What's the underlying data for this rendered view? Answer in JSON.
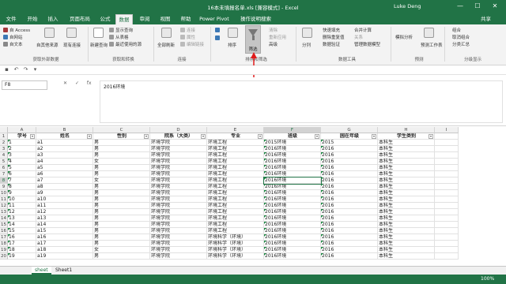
{
  "window": {
    "title": "16本未填报名单.xls [兼容模式] - Excel",
    "user": "Luke Deng",
    "min": "—",
    "max": "☐",
    "close": "✕"
  },
  "tabs": [
    "文件",
    "开始",
    "插入",
    "页面布局",
    "公式",
    "数据",
    "审阅",
    "视图",
    "帮助",
    "Power Pivot"
  ],
  "active_tab": "数据",
  "tell_me": "操作说明搜索",
  "share": "共享",
  "ribbon": {
    "get_data": {
      "access": "自 Access",
      "web": "自网站",
      "text": "自文本",
      "other": "自其他来源",
      "existing": "现有连接",
      "new_query": "新建查询",
      "show_query": "显示查询",
      "from_table": "从表格",
      "recent": "最近使用的源",
      "group1": "获取外部数据",
      "group2": "获取和转换"
    },
    "connections": {
      "refresh": "全部刷新",
      "conn": "连接",
      "props": "属性",
      "edit_links": "编辑链接",
      "group": "连接"
    },
    "sort_filter": {
      "sort": "排序",
      "filter": "筛选",
      "clear": "清除",
      "reapply": "重新应用",
      "advanced": "高级",
      "group": "排序和筛选"
    },
    "data_tools": {
      "split": "分列",
      "flash": "快速填充",
      "remove_dup": "删除重复值",
      "validation": "数据验证",
      "consolidate": "合并计算",
      "relations": "关系",
      "model": "管理数据模型",
      "group": "数据工具"
    },
    "forecast": {
      "what_if": "模拟分析",
      "sheet": "预测工作表",
      "group": "预测"
    },
    "outline": {
      "group_btn": "组合",
      "ungroup": "取消组合",
      "subtotal": "分类汇总",
      "group": "分级显示"
    }
  },
  "name_box": "F8",
  "formula": "2016环境",
  "columns": [
    "A",
    "B",
    "C",
    "D",
    "E",
    "F",
    "G",
    "H",
    "I"
  ],
  "selected_column": "F",
  "selected_row": 8,
  "headers": [
    "学号",
    "姓名",
    "性别",
    "院系（大类）",
    "专业",
    "班级",
    "园在年级",
    "学生类别"
  ],
  "rows": [
    [
      "1",
      "a1",
      "男",
      "环境学院",
      "环境工程",
      "2015环境",
      "2015",
      "本科生"
    ],
    [
      "2",
      "a2",
      "男",
      "环境学院",
      "环境工程",
      "2016环境",
      "2016",
      "本科生"
    ],
    [
      "3",
      "a3",
      "男",
      "环境学院",
      "环境工程",
      "2016环境",
      "2016",
      "本科生"
    ],
    [
      "4",
      "a4",
      "女",
      "环境学院",
      "环境工程",
      "2016环境",
      "2016",
      "本科生"
    ],
    [
      "5",
      "a5",
      "男",
      "环境学院",
      "环境工程",
      "2016环境",
      "2016",
      "本科生"
    ],
    [
      "6",
      "a6",
      "男",
      "环境学院",
      "环境工程",
      "2016环境",
      "2016",
      "本科生"
    ],
    [
      "7",
      "a7",
      "女",
      "环境学院",
      "环境工程",
      "2016环境",
      "2016",
      "本科生"
    ],
    [
      "8",
      "a8",
      "男",
      "环境学院",
      "环境工程",
      "2016环境",
      "2016",
      "本科生"
    ],
    [
      "9",
      "a9",
      "男",
      "环境学院",
      "环境工程",
      "2016环境",
      "2016",
      "本科生"
    ],
    [
      "10",
      "a10",
      "男",
      "环境学院",
      "环境工程",
      "2016环境",
      "2016",
      "本科生"
    ],
    [
      "11",
      "a11",
      "男",
      "环境学院",
      "环境工程",
      "2016环境",
      "2016",
      "本科生"
    ],
    [
      "12",
      "a12",
      "男",
      "环境学院",
      "环境工程",
      "2016环境",
      "2016",
      "本科生"
    ],
    [
      "13",
      "a13",
      "男",
      "环境学院",
      "环境工程",
      "2016环境",
      "2016",
      "本科生"
    ],
    [
      "14",
      "a14",
      "男",
      "环境学院",
      "环境工程",
      "2016环境",
      "2016",
      "本科生"
    ],
    [
      "15",
      "a15",
      "男",
      "环境学院",
      "环境工程",
      "2016环境",
      "2016",
      "本科生"
    ],
    [
      "16",
      "a16",
      "男",
      "环境学院",
      "环境科学（环境）",
      "2016环境",
      "2016",
      "本科生"
    ],
    [
      "17",
      "a17",
      "男",
      "环境学院",
      "环境科学（环境）",
      "2016环境",
      "2016",
      "本科生"
    ],
    [
      "18",
      "a18",
      "女",
      "环境学院",
      "环境科学（环境）",
      "2016环境",
      "2016",
      "本科生"
    ],
    [
      "19",
      "a19",
      "男",
      "环境学院",
      "环境科学（环境）",
      "2016环境",
      "2016",
      "本科生"
    ]
  ],
  "sheets": [
    "sheet",
    "Sheet1"
  ],
  "active_sheet": "sheet",
  "status": {
    "zoom": "100%"
  }
}
